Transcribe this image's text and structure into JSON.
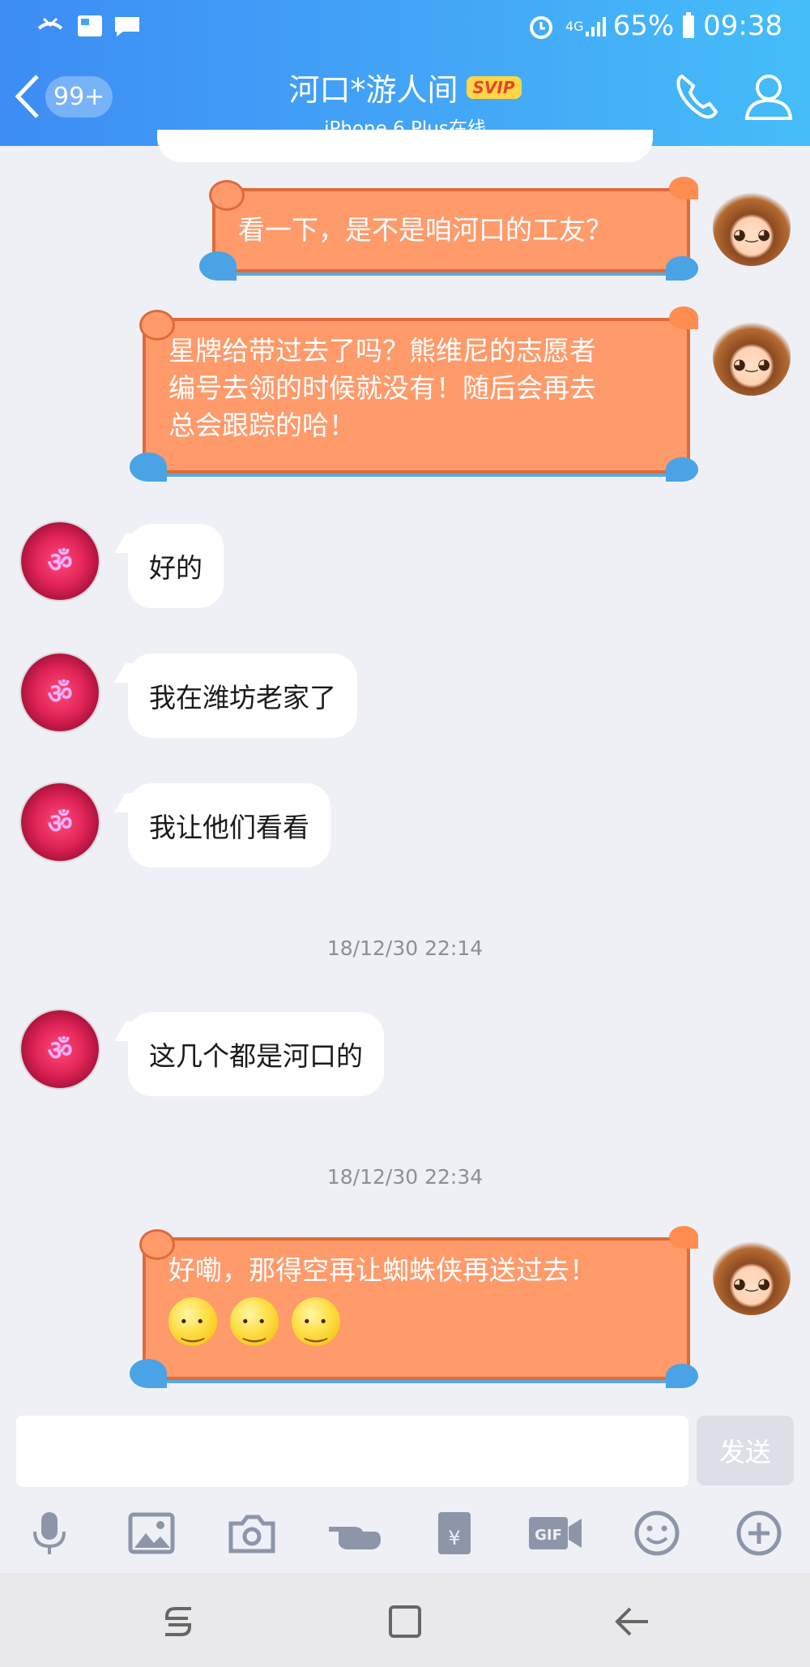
{
  "status_bar": {
    "battery": "65%",
    "time": "09:38",
    "network": "4G"
  },
  "header": {
    "back_count": "99+",
    "title": "河口*游人间",
    "badge": "SVIP",
    "subtitle": "iPhone 6 Plus在线"
  },
  "messages": [
    {
      "side": "out",
      "text": "看一下，是不是咱河口的工友？"
    },
    {
      "side": "out",
      "lines": [
        "星牌给带过去了吗？熊维尼的志愿者",
        "编号去领的时候就没有！随后会再去",
        "总会跟踪的哈！"
      ]
    },
    {
      "side": "in",
      "text": "好的"
    },
    {
      "side": "in",
      "text": "我在潍坊老家了"
    },
    {
      "side": "in",
      "text": "我让他们看看"
    },
    {
      "type": "timestamp",
      "text": "18/12/30 22:14"
    },
    {
      "side": "in",
      "text": "这几个都是河口的"
    },
    {
      "type": "timestamp",
      "text": "18/12/30 22:34"
    },
    {
      "side": "out",
      "text": "好嘞，那得空再让蜘蛛侠再送过去！"
    }
  ],
  "input": {
    "send_label": "发送",
    "value": ""
  },
  "toolbar": [
    "microphone-icon",
    "image-icon",
    "camera-icon",
    "poke-icon",
    "red-packet-icon",
    "gif-icon",
    "emoji-icon",
    "plus-icon"
  ],
  "colors": {
    "header_start": "#3d8df4",
    "header_end": "#45bdf8",
    "out_bubble": "#ff9a6b",
    "in_bubble": "#ffffff"
  }
}
